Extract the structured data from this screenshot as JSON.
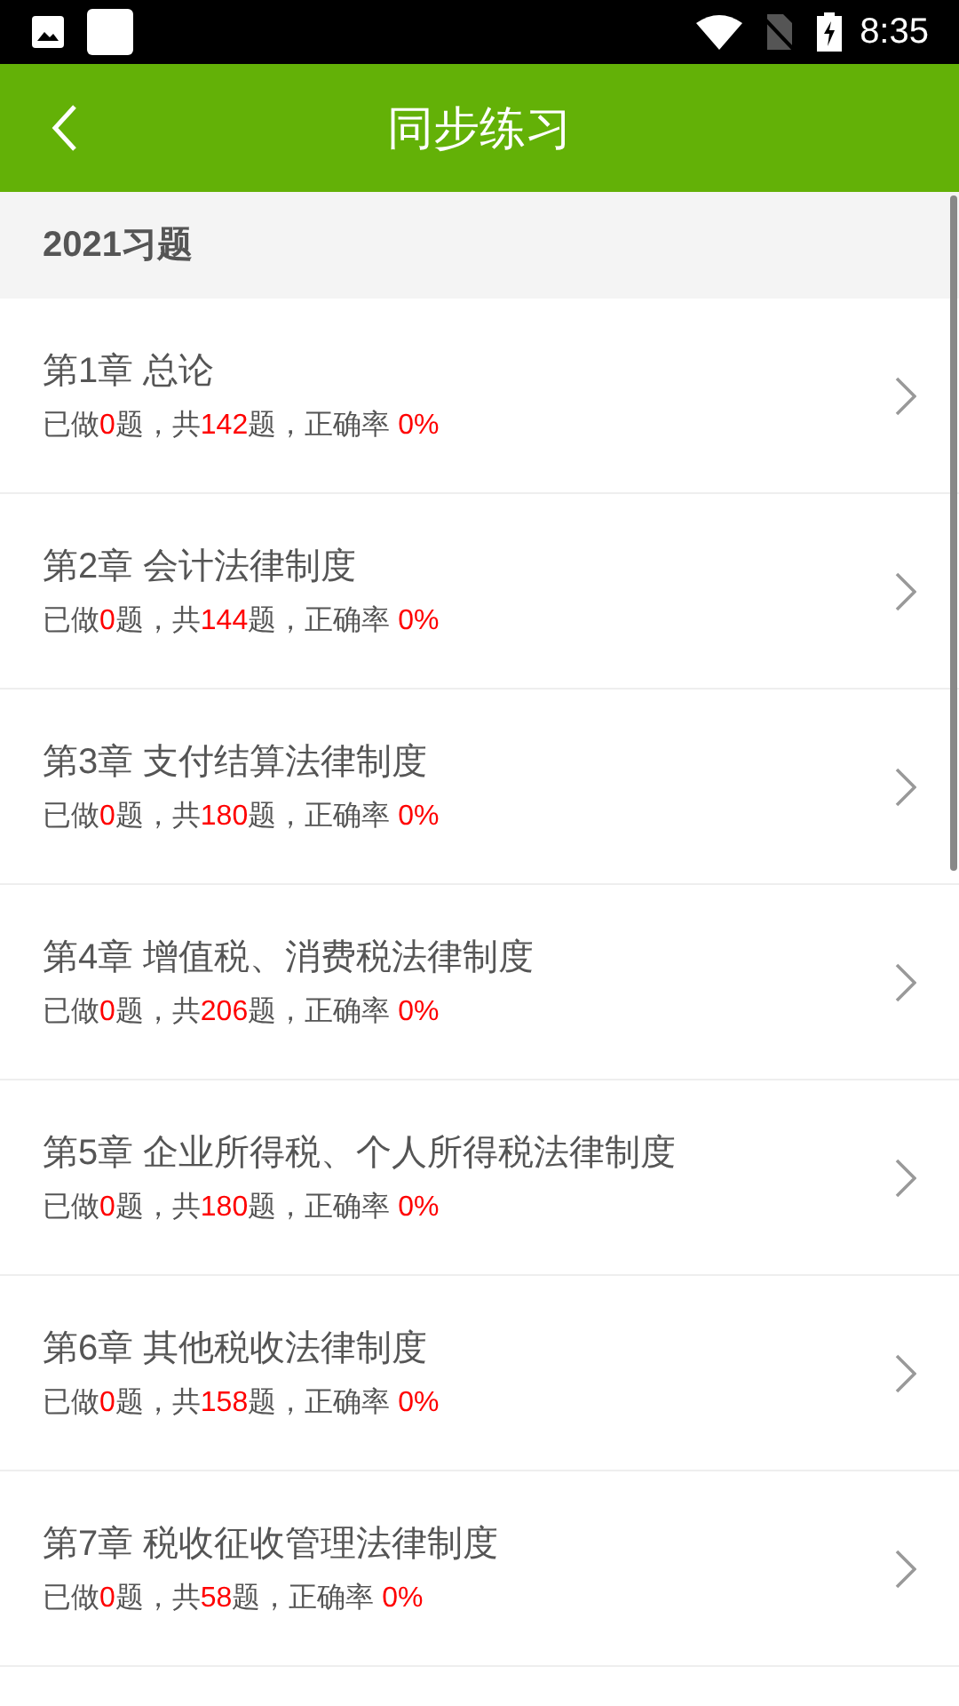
{
  "status_bar": {
    "time": "8:35"
  },
  "header": {
    "title": "同步练习"
  },
  "section": {
    "title": "2021习题"
  },
  "chapters": [
    {
      "title": "第1章 总论",
      "stats": [
        {
          "text": "已做",
          "highlight": false
        },
        {
          "text": "0",
          "highlight": true
        },
        {
          "text": "题，共",
          "highlight": false
        },
        {
          "text": "142",
          "highlight": true
        },
        {
          "text": "题，正确率 ",
          "highlight": false
        },
        {
          "text": "0%",
          "highlight": true
        }
      ]
    },
    {
      "title": "第2章 会计法律制度",
      "stats": [
        {
          "text": "已做",
          "highlight": false
        },
        {
          "text": "0",
          "highlight": true
        },
        {
          "text": "题，共",
          "highlight": false
        },
        {
          "text": "144",
          "highlight": true
        },
        {
          "text": "题，正确率 ",
          "highlight": false
        },
        {
          "text": "0%",
          "highlight": true
        }
      ]
    },
    {
      "title": "第3章 支付结算法律制度",
      "stats": [
        {
          "text": "已做",
          "highlight": false
        },
        {
          "text": "0",
          "highlight": true
        },
        {
          "text": "题，共",
          "highlight": false
        },
        {
          "text": "180",
          "highlight": true
        },
        {
          "text": "题，正确率 ",
          "highlight": false
        },
        {
          "text": "0%",
          "highlight": true
        }
      ]
    },
    {
      "title": "第4章 增值税、消费税法律制度",
      "stats": [
        {
          "text": "已做",
          "highlight": false
        },
        {
          "text": "0",
          "highlight": true
        },
        {
          "text": "题，共",
          "highlight": false
        },
        {
          "text": "206",
          "highlight": true
        },
        {
          "text": "题，正确率 ",
          "highlight": false
        },
        {
          "text": "0%",
          "highlight": true
        }
      ]
    },
    {
      "title": "第5章 企业所得税、个人所得税法律制度",
      "stats": [
        {
          "text": "已做",
          "highlight": false
        },
        {
          "text": "0",
          "highlight": true
        },
        {
          "text": "题，共",
          "highlight": false
        },
        {
          "text": "180",
          "highlight": true
        },
        {
          "text": "题，正确率 ",
          "highlight": false
        },
        {
          "text": "0%",
          "highlight": true
        }
      ]
    },
    {
      "title": "第6章 其他税收法律制度",
      "stats": [
        {
          "text": "已做",
          "highlight": false
        },
        {
          "text": "0",
          "highlight": true
        },
        {
          "text": "题，共",
          "highlight": false
        },
        {
          "text": "158",
          "highlight": true
        },
        {
          "text": "题，正确率 ",
          "highlight": false
        },
        {
          "text": "0%",
          "highlight": true
        }
      ]
    },
    {
      "title": "第7章 税收征收管理法律制度",
      "stats": [
        {
          "text": "已做",
          "highlight": false
        },
        {
          "text": "0",
          "highlight": true
        },
        {
          "text": "题，共",
          "highlight": false
        },
        {
          "text": "58",
          "highlight": true
        },
        {
          "text": "题，正确率 ",
          "highlight": false
        },
        {
          "text": "0%",
          "highlight": true
        }
      ]
    }
  ]
}
